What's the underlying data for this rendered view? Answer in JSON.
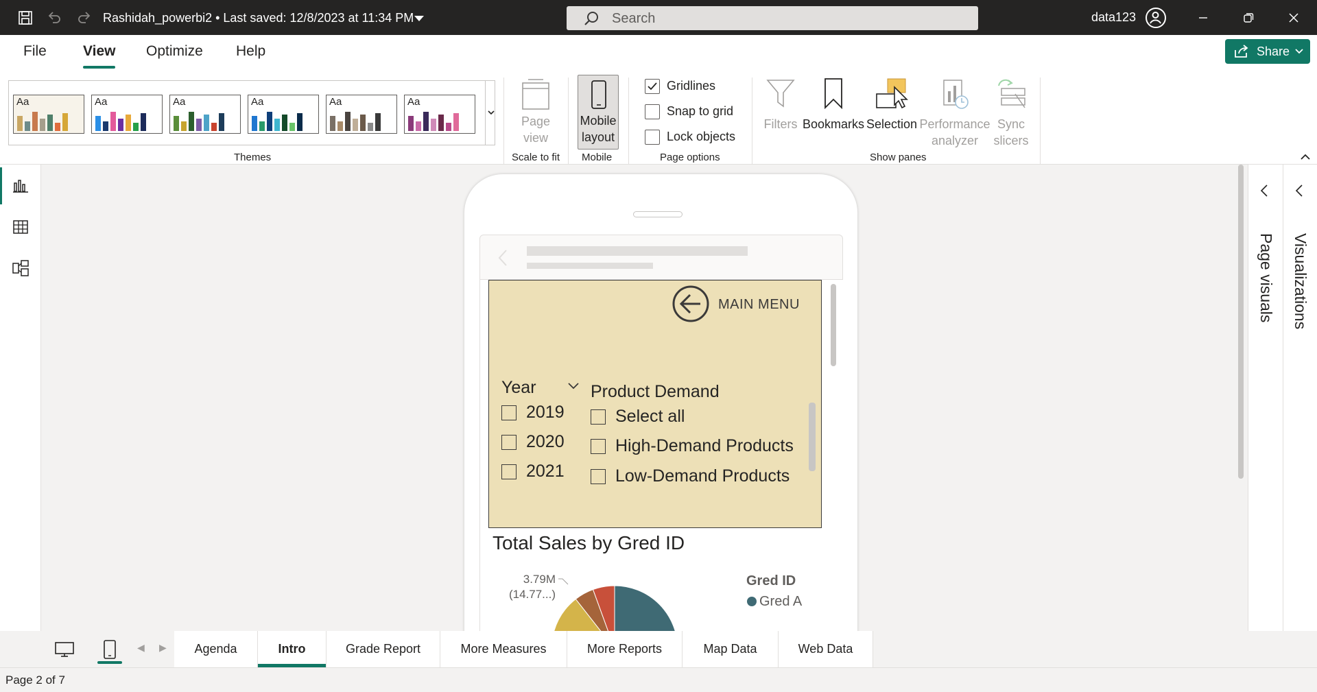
{
  "titlebar": {
    "doc_title": "Rashidah_powerbi2 • Last saved: 12/8/2023 at 11:34 PM",
    "search_placeholder": "Search",
    "user": "data123",
    "icons": [
      "save-icon",
      "undo-icon",
      "redo-icon",
      "search-icon",
      "account-icon",
      "minimize-icon",
      "restore-icon",
      "close-icon"
    ]
  },
  "menu": {
    "items": [
      {
        "label": "File",
        "active": false
      },
      {
        "label": "View",
        "active": true
      },
      {
        "label": "Optimize",
        "active": false
      },
      {
        "label": "Help",
        "active": false
      }
    ],
    "share_label": "Share",
    "accent": "#117865"
  },
  "ribbon": {
    "themes": {
      "label": "Themes",
      "sample_text": "Aa",
      "swatches": [
        {
          "bg": "#f7f3ea",
          "colors": [
            "#c9a764",
            "#6d8b8a",
            "#c87a4e",
            "#a59e8c",
            "#4f7f6a",
            "#e06c3c",
            "#d6a738"
          ]
        },
        {
          "bg": "#ffffff",
          "colors": [
            "#2b8fe6",
            "#1a3a6e",
            "#e35a9b",
            "#6b2fa1",
            "#e8a93a",
            "#26a04a",
            "#1c2b5a"
          ]
        },
        {
          "bg": "#ffffff",
          "colors": [
            "#5a8e3a",
            "#c7a42e",
            "#2c5f2d",
            "#7d5ba6",
            "#4ea3c8",
            "#c8432e",
            "#1d3d5a"
          ]
        },
        {
          "bg": "#ffffff",
          "colors": [
            "#1f77d0",
            "#2a9a6a",
            "#0f3f7a",
            "#3fb6d0",
            "#144a2a",
            "#6ac46a",
            "#0a2b4a"
          ]
        },
        {
          "bg": "#ffffff",
          "colors": [
            "#7a7066",
            "#a88b6a",
            "#4a4440",
            "#bfae98",
            "#6b5a4a",
            "#8a8a8a",
            "#3a3a3a"
          ]
        },
        {
          "bg": "#ffffff",
          "colors": [
            "#8a3a7a",
            "#c96aa8",
            "#3a2a5a",
            "#d08ab8",
            "#6a2a4a",
            "#b84a8a",
            "#e06a9a"
          ]
        }
      ]
    },
    "scale_to_fit": {
      "button": "Page view",
      "label": "Scale to fit"
    },
    "mobile": {
      "button": "Mobile layout",
      "label": "Mobile"
    },
    "page_options": {
      "label": "Page options",
      "checks": [
        {
          "label": "Gridlines",
          "checked": true
        },
        {
          "label": "Snap to grid",
          "checked": false
        },
        {
          "label": "Lock objects",
          "checked": false
        }
      ]
    },
    "show_panes": {
      "label": "Show panes",
      "buttons": [
        {
          "label": "Filters",
          "enabled": false
        },
        {
          "label": "Bookmarks",
          "enabled": true
        },
        {
          "label": "Selection",
          "enabled": true
        },
        {
          "label": "Performance analyzer",
          "enabled": false
        },
        {
          "label": "Sync slicers",
          "enabled": false
        }
      ]
    }
  },
  "left_nav": [
    "report-view",
    "table-view",
    "model-view"
  ],
  "mobile_page": {
    "main_menu_label": "MAIN MENU",
    "panel_color": "#ede0b7",
    "year_slicer": {
      "title": "Year",
      "items": [
        "2019",
        "2020",
        "2021"
      ]
    },
    "demand_slicer": {
      "title": "Product Demand",
      "items": [
        "Select all",
        "High-Demand Products",
        "Low-Demand Products"
      ]
    },
    "chart": {
      "title": "Total Sales by Gred ID",
      "legend_title": "Gred ID",
      "legend_items": [
        {
          "name": "Gred A",
          "color": "#3f6a74"
        }
      ],
      "data_label_value": "3.79M",
      "data_label_pct": "(14.77...)"
    }
  },
  "chart_data": {
    "type": "pie",
    "title": "Total Sales by Gred ID",
    "legend_title": "Gred ID",
    "slices": [
      {
        "name": "Gred A",
        "color": "#3f6a74",
        "value": null
      },
      {
        "name": "",
        "color": "#d4b44a",
        "value": 3.79,
        "label": "3.79M (14.77...)"
      },
      {
        "name": "",
        "color": "#a5643a",
        "value": null
      },
      {
        "name": "",
        "color": "#c8503a",
        "value": null
      }
    ]
  },
  "right_panes": {
    "page_visuals": "Page visuals",
    "visualizations": "Visualizations"
  },
  "tabs": [
    {
      "label": "Agenda",
      "active": false
    },
    {
      "label": "Intro",
      "active": true
    },
    {
      "label": "Grade Report",
      "active": false
    },
    {
      "label": "More Measures",
      "active": false
    },
    {
      "label": "More Reports",
      "active": false
    },
    {
      "label": "Map Data",
      "active": false
    },
    {
      "label": "Web Data",
      "active": false
    }
  ],
  "status": {
    "page_info": "Page 2 of 7"
  }
}
